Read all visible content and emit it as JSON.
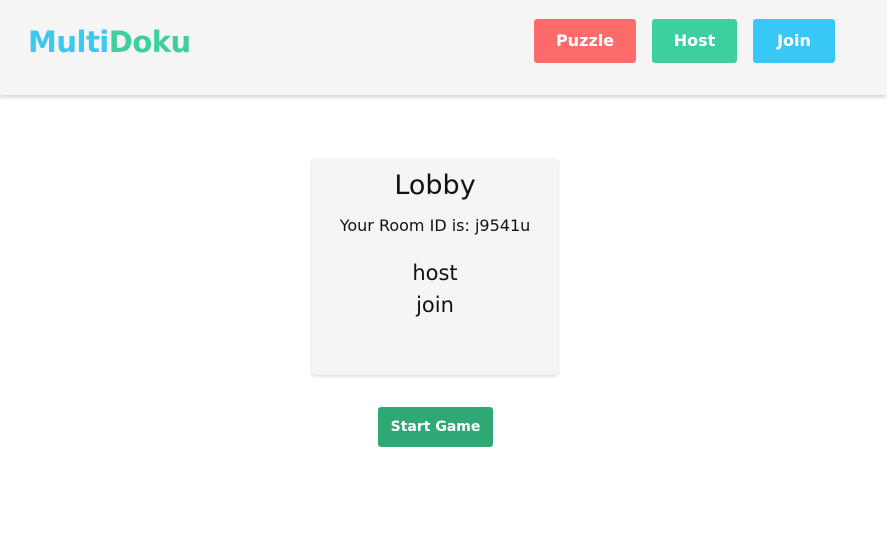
{
  "header": {
    "logo": {
      "part1": "Multi",
      "part2": "Doku"
    },
    "nav": [
      {
        "label": "Puzzle",
        "color": "#ff6b6b"
      },
      {
        "label": "Host",
        "color": "#3ccfa0"
      },
      {
        "label": "Join",
        "color": "#38c8f8"
      }
    ]
  },
  "lobby": {
    "title": "Lobby",
    "room_id_text": "Your Room ID is: j9541u",
    "players": [
      "host",
      "join"
    ]
  },
  "actions": {
    "start_label": "Start Game",
    "start_color": "#2ea874"
  },
  "colors": {
    "logo_multi": "#3cc8f2",
    "logo_doku": "#3ecf9c"
  }
}
